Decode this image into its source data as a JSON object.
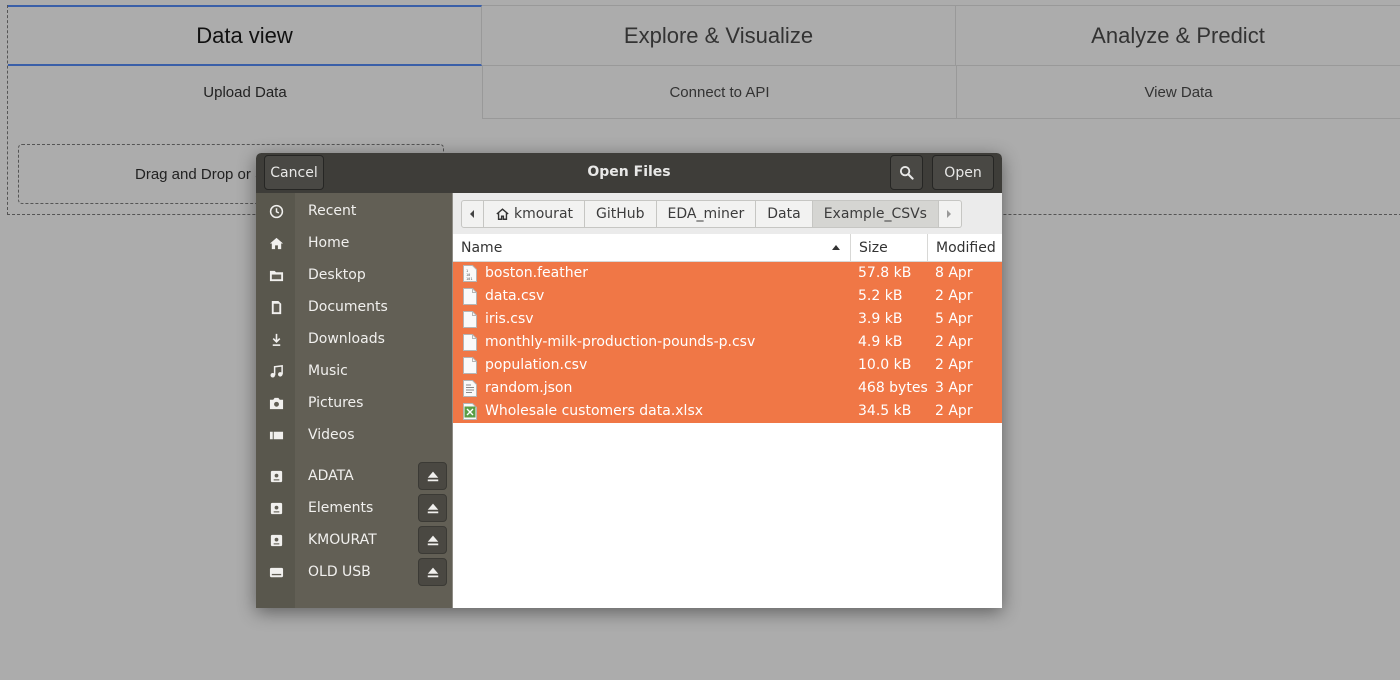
{
  "app": {
    "tabs": [
      {
        "label": "Data view",
        "active": true
      },
      {
        "label": "Explore & Visualize",
        "active": false
      },
      {
        "label": "Analyze & Predict",
        "active": false
      }
    ],
    "subtabs": [
      "Upload Data",
      "Connect to API",
      "View Data"
    ],
    "dropzone_text": "Drag and Drop or S"
  },
  "dialog": {
    "title": "Open Files",
    "cancel_label": "Cancel",
    "open_label": "Open",
    "search_icon": "search-icon",
    "places": [
      {
        "label": "Recent",
        "icon": "clock-icon"
      },
      {
        "label": "Home",
        "icon": "home-icon"
      },
      {
        "label": "Desktop",
        "icon": "folder-icon"
      },
      {
        "label": "Documents",
        "icon": "document-icon"
      },
      {
        "label": "Downloads",
        "icon": "download-icon"
      },
      {
        "label": "Music",
        "icon": "music-icon"
      },
      {
        "label": "Pictures",
        "icon": "camera-icon"
      },
      {
        "label": "Videos",
        "icon": "video-icon"
      }
    ],
    "devices": [
      {
        "label": "ADATA",
        "icon": "drive-icon"
      },
      {
        "label": "Elements",
        "icon": "drive-icon"
      },
      {
        "label": "KMOURAT",
        "icon": "drive-icon"
      },
      {
        "label": "OLD USB",
        "icon": "removable-drive-icon"
      }
    ],
    "path": [
      "kmourat",
      "GitHub",
      "EDA_miner",
      "Data",
      "Example_CSVs"
    ],
    "columns": {
      "name": "Name",
      "size": "Size",
      "modified": "Modified"
    },
    "files": [
      {
        "name": "boston.feather",
        "size": "57.8 kB",
        "modified": "8 Apr",
        "icon": "binary-file-icon"
      },
      {
        "name": "data.csv",
        "size": "5.2 kB",
        "modified": "2 Apr",
        "icon": "file-icon"
      },
      {
        "name": "iris.csv",
        "size": "3.9 kB",
        "modified": "5 Apr",
        "icon": "file-icon"
      },
      {
        "name": "monthly-milk-production-pounds-p.csv",
        "size": "4.9 kB",
        "modified": "2 Apr",
        "icon": "file-icon"
      },
      {
        "name": "population.csv",
        "size": "10.0 kB",
        "modified": "2 Apr",
        "icon": "file-icon"
      },
      {
        "name": "random.json",
        "size": "468 bytes",
        "modified": "3 Apr",
        "icon": "text-file-icon"
      },
      {
        "name": "Wholesale customers data.xlsx",
        "size": "34.5 kB",
        "modified": "2 Apr",
        "icon": "spreadsheet-icon"
      }
    ],
    "colors": {
      "selection": "#f07746",
      "header": "#3e3d39",
      "sidebar": "#625f55"
    }
  }
}
